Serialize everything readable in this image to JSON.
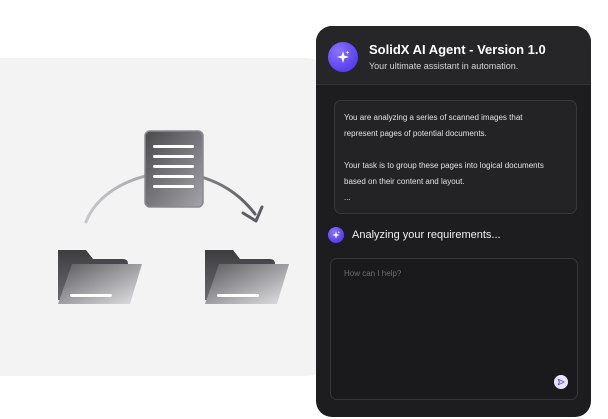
{
  "colors": {
    "accent": "#6a4ff5",
    "window_background": "#1d1d1f",
    "panel_background": "#f3f3f4"
  },
  "illustration": {
    "icons": [
      "document-icon",
      "folder-icon",
      "folder-icon",
      "curved-arrow-icon"
    ]
  },
  "agent": {
    "avatar_icon": "sparkle-icon",
    "title": "SolidX AI Agent - Version 1.0",
    "subtitle": "Your ultimate assistant in automation.",
    "prompt": {
      "line1": "You are analyzing a series of scanned images that",
      "line2": "represent pages of potential documents.",
      "line3": "Your task is to group these pages into logical documents",
      "line4": "based on their content and layout.",
      "line5": "..."
    },
    "status": {
      "icon": "sparkle-icon",
      "text": "Analyzing your requirements..."
    },
    "input": {
      "placeholder": "How can I help?",
      "value": ""
    },
    "send_icon": "send-icon"
  }
}
